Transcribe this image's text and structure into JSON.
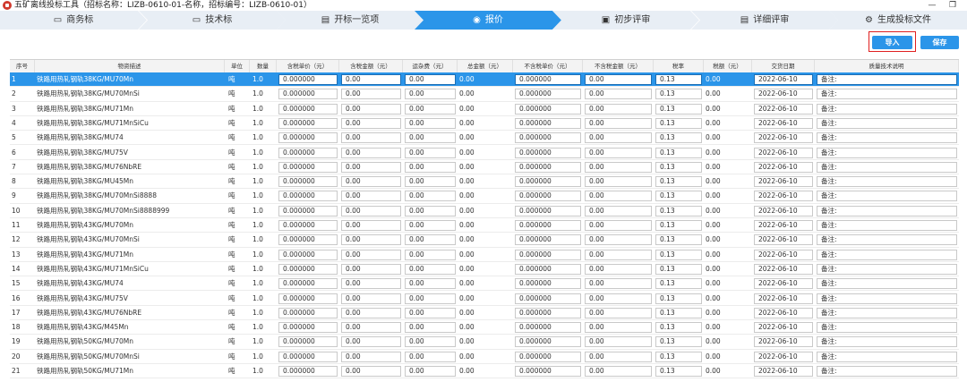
{
  "window": {
    "app_name": "五矿离线投标工具",
    "title_info": "（招标名称：LIZB-0610-01-名称，招标编号：LIZB-0610-01）",
    "min_glyph": "—",
    "max_glyph": "❐"
  },
  "steps": [
    {
      "label": "商务标",
      "icon": "briefcase-icon",
      "glyph": "▭"
    },
    {
      "label": "技术标",
      "icon": "monitor-icon",
      "glyph": "▭"
    },
    {
      "label": "开标一览项",
      "icon": "document-icon",
      "glyph": "▤"
    },
    {
      "label": "报价",
      "icon": "target-icon",
      "glyph": "◉",
      "active": true
    },
    {
      "label": "初步评审",
      "icon": "review-icon",
      "glyph": "▣"
    },
    {
      "label": "详细评审",
      "icon": "detail-icon",
      "glyph": "▤"
    },
    {
      "label": "生成投标文件",
      "icon": "generate-icon",
      "glyph": "⚙"
    }
  ],
  "toolbar": {
    "import_label": "导入",
    "save_label": "保存"
  },
  "columns": [
    "序号",
    "物资描述",
    "单位",
    "数量",
    "含税单价（元）",
    "含税金额（元）",
    "运杂费（元）",
    "总金额（元）",
    "不含税单价（元）",
    "不含税金额（元）",
    "税率",
    "税额（元）",
    "交货日期",
    "质量技术说明"
  ],
  "rows": [
    {
      "no": "1",
      "desc": "铁路用热轧钢轨38KG/MU70Mn",
      "unit": "吨",
      "qty": "1.0",
      "price_tax": "0.000000",
      "amount_tax": "0.00",
      "freight": "0.00",
      "total": "0.00",
      "price_notax": "0.000000",
      "amount_notax": "0.00",
      "tax_rate": "0.13",
      "tax": "0.00",
      "date": "2022-06-10",
      "remark": "备注:"
    },
    {
      "no": "2",
      "desc": "铁路用热轧钢轨38KG/MU70MnSi",
      "unit": "吨",
      "qty": "1.0",
      "price_tax": "0.000000",
      "amount_tax": "0.00",
      "freight": "0.00",
      "total": "0.00",
      "price_notax": "0.000000",
      "amount_notax": "0.00",
      "tax_rate": "0.13",
      "tax": "0.00",
      "date": "2022-06-10",
      "remark": "备注:"
    },
    {
      "no": "3",
      "desc": "铁路用热轧钢轨38KG/MU71Mn",
      "unit": "吨",
      "qty": "1.0",
      "price_tax": "0.000000",
      "amount_tax": "0.00",
      "freight": "0.00",
      "total": "0.00",
      "price_notax": "0.000000",
      "amount_notax": "0.00",
      "tax_rate": "0.13",
      "tax": "0.00",
      "date": "2022-06-10",
      "remark": "备注:"
    },
    {
      "no": "4",
      "desc": "铁路用热轧钢轨38KG/MU71MnSiCu",
      "unit": "吨",
      "qty": "1.0",
      "price_tax": "0.000000",
      "amount_tax": "0.00",
      "freight": "0.00",
      "total": "0.00",
      "price_notax": "0.000000",
      "amount_notax": "0.00",
      "tax_rate": "0.13",
      "tax": "0.00",
      "date": "2022-06-10",
      "remark": "备注:"
    },
    {
      "no": "5",
      "desc": "铁路用热轧钢轨38KG/MU74",
      "unit": "吨",
      "qty": "1.0",
      "price_tax": "0.000000",
      "amount_tax": "0.00",
      "freight": "0.00",
      "total": "0.00",
      "price_notax": "0.000000",
      "amount_notax": "0.00",
      "tax_rate": "0.13",
      "tax": "0.00",
      "date": "2022-06-10",
      "remark": "备注:"
    },
    {
      "no": "6",
      "desc": "铁路用热轧钢轨38KG/MU75V",
      "unit": "吨",
      "qty": "1.0",
      "price_tax": "0.000000",
      "amount_tax": "0.00",
      "freight": "0.00",
      "total": "0.00",
      "price_notax": "0.000000",
      "amount_notax": "0.00",
      "tax_rate": "0.13",
      "tax": "0.00",
      "date": "2022-06-10",
      "remark": "备注:"
    },
    {
      "no": "7",
      "desc": "铁路用热轧钢轨38KG/MU76NbRE",
      "unit": "吨",
      "qty": "1.0",
      "price_tax": "0.000000",
      "amount_tax": "0.00",
      "freight": "0.00",
      "total": "0.00",
      "price_notax": "0.000000",
      "amount_notax": "0.00",
      "tax_rate": "0.13",
      "tax": "0.00",
      "date": "2022-06-10",
      "remark": "备注:"
    },
    {
      "no": "8",
      "desc": "铁路用热轧钢轨38KG/MU45Mn",
      "unit": "吨",
      "qty": "1.0",
      "price_tax": "0.000000",
      "amount_tax": "0.00",
      "freight": "0.00",
      "total": "0.00",
      "price_notax": "0.000000",
      "amount_notax": "0.00",
      "tax_rate": "0.13",
      "tax": "0.00",
      "date": "2022-06-10",
      "remark": "备注:"
    },
    {
      "no": "9",
      "desc": "铁路用热轧钢轨38KG/MU70MnSi8888",
      "unit": "吨",
      "qty": "1.0",
      "price_tax": "0.000000",
      "amount_tax": "0.00",
      "freight": "0.00",
      "total": "0.00",
      "price_notax": "0.000000",
      "amount_notax": "0.00",
      "tax_rate": "0.13",
      "tax": "0.00",
      "date": "2022-06-10",
      "remark": "备注:"
    },
    {
      "no": "10",
      "desc": "铁路用热轧钢轨38KG/MU70MnSi8888999",
      "unit": "吨",
      "qty": "1.0",
      "price_tax": "0.000000",
      "amount_tax": "0.00",
      "freight": "0.00",
      "total": "0.00",
      "price_notax": "0.000000",
      "amount_notax": "0.00",
      "tax_rate": "0.13",
      "tax": "0.00",
      "date": "2022-06-10",
      "remark": "备注:"
    },
    {
      "no": "11",
      "desc": "铁路用热轧钢轨43KG/MU70Mn",
      "unit": "吨",
      "qty": "1.0",
      "price_tax": "0.000000",
      "amount_tax": "0.00",
      "freight": "0.00",
      "total": "0.00",
      "price_notax": "0.000000",
      "amount_notax": "0.00",
      "tax_rate": "0.13",
      "tax": "0.00",
      "date": "2022-06-10",
      "remark": "备注:"
    },
    {
      "no": "12",
      "desc": "铁路用热轧钢轨43KG/MU70MnSi",
      "unit": "吨",
      "qty": "1.0",
      "price_tax": "0.000000",
      "amount_tax": "0.00",
      "freight": "0.00",
      "total": "0.00",
      "price_notax": "0.000000",
      "amount_notax": "0.00",
      "tax_rate": "0.13",
      "tax": "0.00",
      "date": "2022-06-10",
      "remark": "备注:"
    },
    {
      "no": "13",
      "desc": "铁路用热轧钢轨43KG/MU71Mn",
      "unit": "吨",
      "qty": "1.0",
      "price_tax": "0.000000",
      "amount_tax": "0.00",
      "freight": "0.00",
      "total": "0.00",
      "price_notax": "0.000000",
      "amount_notax": "0.00",
      "tax_rate": "0.13",
      "tax": "0.00",
      "date": "2022-06-10",
      "remark": "备注:"
    },
    {
      "no": "14",
      "desc": "铁路用热轧钢轨43KG/MU71MnSiCu",
      "unit": "吨",
      "qty": "1.0",
      "price_tax": "0.000000",
      "amount_tax": "0.00",
      "freight": "0.00",
      "total": "0.00",
      "price_notax": "0.000000",
      "amount_notax": "0.00",
      "tax_rate": "0.13",
      "tax": "0.00",
      "date": "2022-06-10",
      "remark": "备注:"
    },
    {
      "no": "15",
      "desc": "铁路用热轧钢轨43KG/MU74",
      "unit": "吨",
      "qty": "1.0",
      "price_tax": "0.000000",
      "amount_tax": "0.00",
      "freight": "0.00",
      "total": "0.00",
      "price_notax": "0.000000",
      "amount_notax": "0.00",
      "tax_rate": "0.13",
      "tax": "0.00",
      "date": "2022-06-10",
      "remark": "备注:"
    },
    {
      "no": "16",
      "desc": "铁路用热轧钢轨43KG/MU75V",
      "unit": "吨",
      "qty": "1.0",
      "price_tax": "0.000000",
      "amount_tax": "0.00",
      "freight": "0.00",
      "total": "0.00",
      "price_notax": "0.000000",
      "amount_notax": "0.00",
      "tax_rate": "0.13",
      "tax": "0.00",
      "date": "2022-06-10",
      "remark": "备注:"
    },
    {
      "no": "17",
      "desc": "铁路用热轧钢轨43KG/MU76NbRE",
      "unit": "吨",
      "qty": "1.0",
      "price_tax": "0.000000",
      "amount_tax": "0.00",
      "freight": "0.00",
      "total": "0.00",
      "price_notax": "0.000000",
      "amount_notax": "0.00",
      "tax_rate": "0.13",
      "tax": "0.00",
      "date": "2022-06-10",
      "remark": "备注:"
    },
    {
      "no": "18",
      "desc": "铁路用热轧钢轨43KG/M45Mn",
      "unit": "吨",
      "qty": "1.0",
      "price_tax": "0.000000",
      "amount_tax": "0.00",
      "freight": "0.00",
      "total": "0.00",
      "price_notax": "0.000000",
      "amount_notax": "0.00",
      "tax_rate": "0.13",
      "tax": "0.00",
      "date": "2022-06-10",
      "remark": "备注:"
    },
    {
      "no": "19",
      "desc": "铁路用热轧钢轨50KG/MU70Mn",
      "unit": "吨",
      "qty": "1.0",
      "price_tax": "0.000000",
      "amount_tax": "0.00",
      "freight": "0.00",
      "total": "0.00",
      "price_notax": "0.000000",
      "amount_notax": "0.00",
      "tax_rate": "0.13",
      "tax": "0.00",
      "date": "2022-06-10",
      "remark": "备注:"
    },
    {
      "no": "20",
      "desc": "铁路用热轧钢轨50KG/MU70MnSi",
      "unit": "吨",
      "qty": "1.0",
      "price_tax": "0.000000",
      "amount_tax": "0.00",
      "freight": "0.00",
      "total": "0.00",
      "price_notax": "0.000000",
      "amount_notax": "0.00",
      "tax_rate": "0.13",
      "tax": "0.00",
      "date": "2022-06-10",
      "remark": "备注:"
    },
    {
      "no": "21",
      "desc": "铁路用热轧钢轨50KG/MU71Mn",
      "unit": "吨",
      "qty": "1.0",
      "price_tax": "0.000000",
      "amount_tax": "0.00",
      "freight": "0.00",
      "total": "0.00",
      "price_notax": "0.000000",
      "amount_notax": "0.00",
      "tax_rate": "0.13",
      "tax": "0.00",
      "date": "2022-06-10",
      "remark": "备注:"
    }
  ],
  "selected_row": 0,
  "colors": {
    "accent": "#2b95e9",
    "step_bg": "#e8eef5",
    "highlight": "#e02020"
  }
}
